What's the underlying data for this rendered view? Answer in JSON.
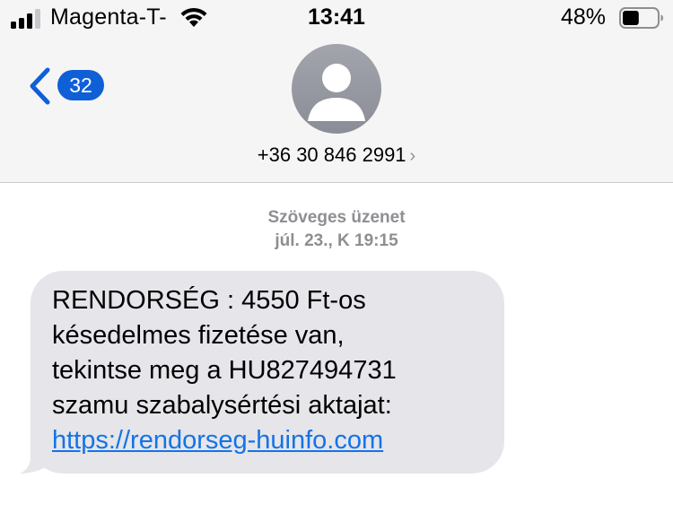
{
  "status_bar": {
    "carrier": "Magenta-T-",
    "time": "13:41",
    "battery_percent": "48%",
    "battery_level": 0.48,
    "signal_bars": 3
  },
  "nav": {
    "back_badge": "32",
    "contact": "+36 30 846 2991",
    "contact_chevron": "›"
  },
  "conversation": {
    "message_type": "Szöveges üzenet",
    "timestamp": "júl. 23., K 19:15",
    "message": {
      "lines": [
        "RENDORSÉG : 4550 Ft-os",
        "késedelmes fizetése van,",
        "tekintse meg a HU827494731",
        "szamu szabalysértési aktajat:"
      ],
      "link": "https://rendorseg-huinfo.com"
    }
  },
  "colors": {
    "accent": "#0f5fd6",
    "link": "#1473e6",
    "bubble": "#e5e5ea",
    "header_bg": "#f5f5f5",
    "meta_text": "#8e8e93"
  },
  "icons": [
    "signal-icon",
    "wifi-icon",
    "battery-icon",
    "back-chevron-icon",
    "contact-avatar-icon"
  ]
}
